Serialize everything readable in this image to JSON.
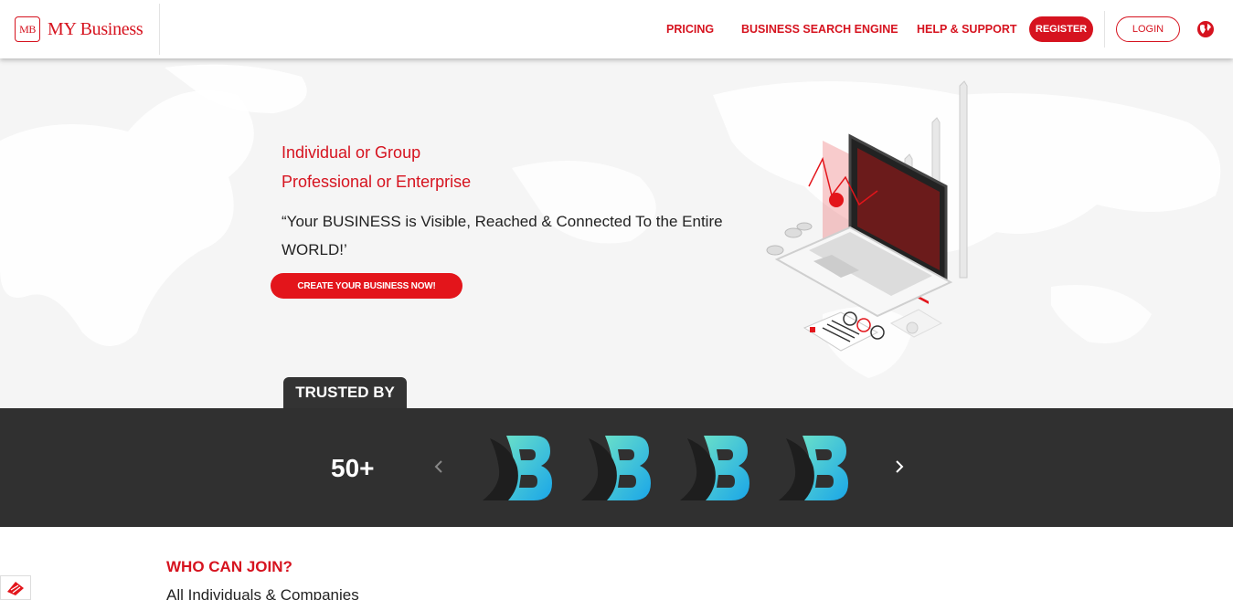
{
  "brand": {
    "mark": "MB",
    "name": "MY Business"
  },
  "nav": {
    "pricing": "PRICING",
    "search_engine": "BUSINESS SEARCH ENGINE",
    "help": "HELP & SUPPORT",
    "register": "REGISTER",
    "login": "LOGIN",
    "language_icon": "globe-icon"
  },
  "hero": {
    "line1": "Individual or Group",
    "line2": "Professional or Enterprise",
    "quote": "“Your BUSINESS is Visible, Reached & Connected To the Entire WORLD!’",
    "cta": "CREATE YOUR BUSINESS NOW!"
  },
  "trusted": {
    "label": "TRUSTED BY",
    "count": "50+",
    "logos": 4
  },
  "who": {
    "title": "WHO CAN JOIN?",
    "subtitle": "All Individuals & Companies"
  },
  "colors": {
    "accent": "#d6131f",
    "band": "#303030",
    "hero_bg": "#f5f5f5"
  }
}
